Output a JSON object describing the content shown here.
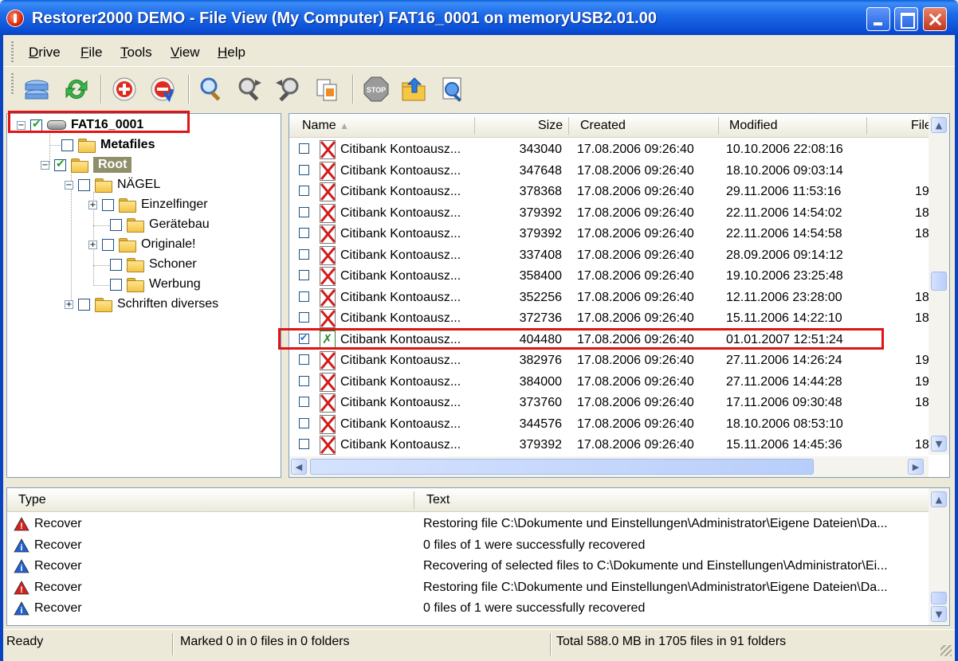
{
  "window": {
    "title": "Restorer2000 DEMO - File View (My Computer) FAT16_0001 on memoryUSB2.01.00"
  },
  "menu": [
    {
      "label": "Drive",
      "accel": "D",
      "rest": "rive"
    },
    {
      "label": "File",
      "accel": "F",
      "rest": "ile"
    },
    {
      "label": "Tools",
      "accel": "T",
      "rest": "ools"
    },
    {
      "label": "View",
      "accel": "V",
      "rest": "iew"
    },
    {
      "label": "Help",
      "accel": "H",
      "rest": "elp"
    }
  ],
  "toolbar": {
    "icons": [
      "drives-icon",
      "refresh-icon",
      "add-region-icon",
      "scan-icon",
      "find-icon",
      "find-next-icon",
      "find-previous-icon",
      "file-mask-icon",
      "stop-icon",
      "open-folder-icon",
      "search-web-icon"
    ]
  },
  "tree": {
    "drive": {
      "label": "FAT16_0001",
      "checked": true
    },
    "metafiles": {
      "label": "Metafiles",
      "checked": false
    },
    "root": {
      "label": "Root",
      "checked": true
    },
    "naegel": {
      "label": "NÄGEL",
      "checked": false
    },
    "einzelfinger": {
      "label": "Einzelfinger",
      "checked": false
    },
    "geraetebau": {
      "label": "Gerätebau",
      "checked": false
    },
    "originale": {
      "label": "Originale!",
      "checked": false
    },
    "schoner": {
      "label": "Schoner",
      "checked": false
    },
    "werbung": {
      "label": "Werbung",
      "checked": false
    },
    "schriften": {
      "label": "Schriften diverses",
      "checked": false
    }
  },
  "file_list": {
    "columns": {
      "name": "Name",
      "size": "Size",
      "created": "Created",
      "modified": "Modified",
      "extra": "File"
    },
    "rows": [
      {
        "name": "Citibank Kontoausz...",
        "size": "343040",
        "created": "17.08.2006 09:26:40",
        "modified": "10.10.2006 22:08:16",
        "extra": "",
        "checked": false,
        "deleted": true
      },
      {
        "name": "Citibank Kontoausz...",
        "size": "347648",
        "created": "17.08.2006 09:26:40",
        "modified": "18.10.2006 09:03:14",
        "extra": "",
        "checked": false,
        "deleted": true
      },
      {
        "name": "Citibank Kontoausz...",
        "size": "378368",
        "created": "17.08.2006 09:26:40",
        "modified": "29.11.2006 11:53:16",
        "extra": "19",
        "checked": false,
        "deleted": true
      },
      {
        "name": "Citibank Kontoausz...",
        "size": "379392",
        "created": "17.08.2006 09:26:40",
        "modified": "22.11.2006 14:54:02",
        "extra": "18",
        "checked": false,
        "deleted": true
      },
      {
        "name": "Citibank Kontoausz...",
        "size": "379392",
        "created": "17.08.2006 09:26:40",
        "modified": "22.11.2006 14:54:58",
        "extra": "18",
        "checked": false,
        "deleted": true
      },
      {
        "name": "Citibank Kontoausz...",
        "size": "337408",
        "created": "17.08.2006 09:26:40",
        "modified": "28.09.2006 09:14:12",
        "extra": "",
        "checked": false,
        "deleted": true
      },
      {
        "name": "Citibank Kontoausz...",
        "size": "358400",
        "created": "17.08.2006 09:26:40",
        "modified": "19.10.2006 23:25:48",
        "extra": "",
        "checked": false,
        "deleted": true
      },
      {
        "name": "Citibank Kontoausz...",
        "size": "352256",
        "created": "17.08.2006 09:26:40",
        "modified": "12.11.2006 23:28:00",
        "extra": "18",
        "checked": false,
        "deleted": true
      },
      {
        "name": "Citibank Kontoausz...",
        "size": "372736",
        "created": "17.08.2006 09:26:40",
        "modified": "15.11.2006 14:22:10",
        "extra": "18",
        "checked": false,
        "deleted": true
      },
      {
        "name": "Citibank Kontoausz...",
        "size": "404480",
        "created": "17.08.2006 09:26:40",
        "modified": "01.01.2007 12:51:24",
        "extra": "",
        "checked": true,
        "deleted": false
      },
      {
        "name": "Citibank Kontoausz...",
        "size": "382976",
        "created": "17.08.2006 09:26:40",
        "modified": "27.11.2006 14:26:24",
        "extra": "19",
        "checked": false,
        "deleted": true
      },
      {
        "name": "Citibank Kontoausz...",
        "size": "384000",
        "created": "17.08.2006 09:26:40",
        "modified": "27.11.2006 14:44:28",
        "extra": "19",
        "checked": false,
        "deleted": true
      },
      {
        "name": "Citibank Kontoausz...",
        "size": "373760",
        "created": "17.08.2006 09:26:40",
        "modified": "17.11.2006 09:30:48",
        "extra": "18",
        "checked": false,
        "deleted": true
      },
      {
        "name": "Citibank Kontoausz...",
        "size": "344576",
        "created": "17.08.2006 09:26:40",
        "modified": "18.10.2006 08:53:10",
        "extra": "",
        "checked": false,
        "deleted": true
      },
      {
        "name": "Citibank Kontoausz...",
        "size": "379392",
        "created": "17.08.2006 09:26:40",
        "modified": "15.11.2006 14:45:36",
        "extra": "18",
        "checked": false,
        "deleted": true
      }
    ]
  },
  "log": {
    "columns": {
      "type": "Type",
      "text": "Text"
    },
    "rows": [
      {
        "level": "error",
        "type": "Recover",
        "text": "Restoring file C:\\Dokumente und Einstellungen\\Administrator\\Eigene Dateien\\Da..."
      },
      {
        "level": "info",
        "type": "Recover",
        "text": "0 files of 1 were successfully recovered"
      },
      {
        "level": "info",
        "type": "Recover",
        "text": "Recovering of selected files to C:\\Dokumente und Einstellungen\\Administrator\\Ei..."
      },
      {
        "level": "error",
        "type": "Recover",
        "text": "Restoring file C:\\Dokumente und Einstellungen\\Administrator\\Eigene Dateien\\Da..."
      },
      {
        "level": "info",
        "type": "Recover",
        "text": "0 files of 1 were successfully recovered"
      }
    ]
  },
  "status": {
    "state": "Ready",
    "marked": "Marked 0 in 0 files in 0 folders",
    "total": "Total 588.0 MB in 1705 files in 91 folders"
  },
  "colors": {
    "titlebar": "#0A5FD9",
    "highlight": "#E01414",
    "error_icon": "#D42020",
    "info_icon": "#2060D0"
  }
}
